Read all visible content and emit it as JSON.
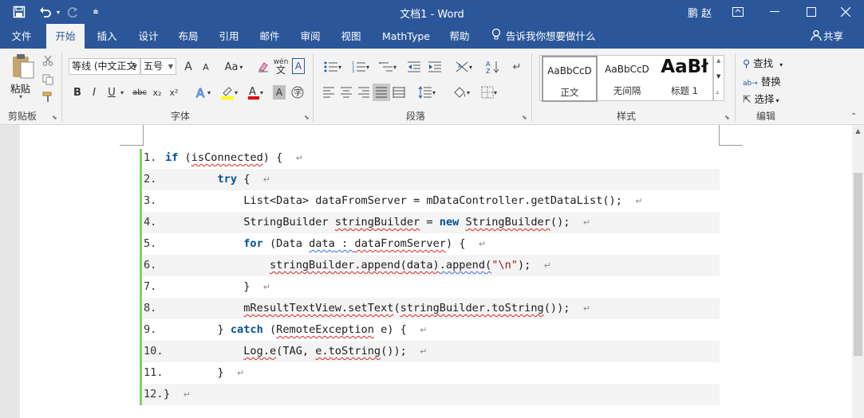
{
  "window": {
    "title": "文档1 - Word",
    "user": "鹏 赵"
  },
  "quick_access": {
    "save_icon": "save-icon",
    "undo_icon": "undo-icon",
    "redo_icon": "redo-icon",
    "customize_icon": "customize-icon"
  },
  "tabs": [
    {
      "label": "文件",
      "active": false
    },
    {
      "label": "开始",
      "active": true
    },
    {
      "label": "插入",
      "active": false
    },
    {
      "label": "设计",
      "active": false
    },
    {
      "label": "布局",
      "active": false
    },
    {
      "label": "引用",
      "active": false
    },
    {
      "label": "邮件",
      "active": false
    },
    {
      "label": "审阅",
      "active": false
    },
    {
      "label": "视图",
      "active": false
    },
    {
      "label": "MathType",
      "active": false
    },
    {
      "label": "帮助",
      "active": false
    }
  ],
  "tell_me": "告诉我你想要做什么",
  "share": "共享",
  "ribbon": {
    "clipboard": {
      "paste_label": "粘贴",
      "group_label": "剪贴板"
    },
    "font": {
      "font_name": "等线 (中文正文",
      "font_size": "五号",
      "group_label": "字体",
      "bold": "B",
      "italic": "I",
      "underline": "U",
      "strike": "abc",
      "subscript": "x₂",
      "superscript": "x²",
      "change_case": "Aa",
      "grow": "A",
      "shrink": "A",
      "wen": "wén",
      "A_box": "A"
    },
    "paragraph": {
      "group_label": "段落"
    },
    "styles": {
      "group_label": "样式",
      "items": [
        {
          "preview": "AaBbCcD",
          "name": "正文"
        },
        {
          "preview": "AaBbCcD",
          "name": "无间隔"
        },
        {
          "preview": "AaBł",
          "name": "标题 1"
        }
      ]
    },
    "editing": {
      "group_label": "编辑",
      "find": "查找",
      "replace": "替换",
      "select": "选择"
    }
  },
  "code_lines": [
    {
      "n": "1.",
      "alt": false
    },
    {
      "n": "2.",
      "alt": true
    },
    {
      "n": "3.",
      "alt": false
    },
    {
      "n": "4.",
      "alt": true
    },
    {
      "n": "5.",
      "alt": false
    },
    {
      "n": "6.",
      "alt": true
    },
    {
      "n": "7.",
      "alt": false
    },
    {
      "n": "8.",
      "alt": true
    },
    {
      "n": "9.",
      "alt": false
    },
    {
      "n": "10.",
      "alt": true
    },
    {
      "n": "11.",
      "alt": false
    },
    {
      "n": "12.",
      "alt": true
    }
  ],
  "code": {
    "l1": {
      "kw": "if",
      "a": " (",
      "b": "isConnected",
      "c": ") {"
    },
    "l2": {
      "kw": "try",
      "a": " {"
    },
    "l3": {
      "a": "List<Data> dataFromServer = mDataController.getDataList();"
    },
    "l4": {
      "a": "StringBuilder ",
      "b": "stringBuilder",
      "c": " = ",
      "kw": "new",
      "d": " ",
      "e": "StringBuilder",
      "f": "();"
    },
    "l5": {
      "kw": "for",
      "a": " (Data ",
      "b": "data",
      "c": " : ",
      "d": "dataFromServer",
      "e": ") {"
    },
    "l6": {
      "a": "stringBuilder.append",
      "b": "(data)",
      "c": ".append",
      "d": "(",
      "s": "\"\\n\"",
      "e": ");"
    },
    "l7": {
      "a": "}"
    },
    "l8": {
      "a": "mResultTextView.setText",
      "b": "(",
      "c": "stringBuilder.toString",
      "d": "());"
    },
    "l9": {
      "a": "} ",
      "kw": "catch",
      "b": " (",
      "c": "RemoteException",
      "d": " e) {"
    },
    "l10": {
      "a": "Log.e",
      "b": "(TAG, ",
      "c": "e.toString",
      "d": "());"
    },
    "l11": {
      "a": "}"
    },
    "l12": {
      "a": "}"
    }
  },
  "paragraph_mark": "↵",
  "colors": {
    "title_bar": "#2b579a",
    "ribbon_bg": "#f3f3f3",
    "code_bar": "#7ed36b",
    "keyword": "#00519c",
    "alt_row": "#f4f4f4"
  }
}
